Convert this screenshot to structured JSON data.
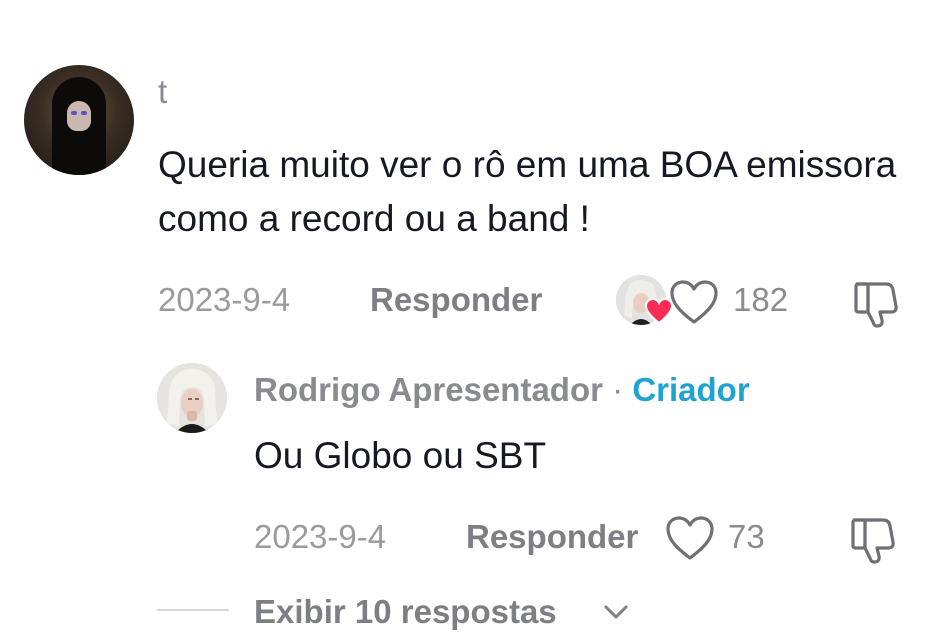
{
  "comment": {
    "username": "t",
    "text": "Queria muito ver o rô em uma BOA emissora como a record ou a band !",
    "date": "2023-9-4",
    "reply_label": "Responder",
    "like_count": "182",
    "avatar_icon": "hooded-figure-avatar",
    "creator_liked_icon": "creator-liked-heart-icon"
  },
  "reply": {
    "username": "Rodrigo Apresentador",
    "separator": "·",
    "creator_badge": "Criador",
    "text": "Ou Globo ou SBT",
    "date": "2023-9-4",
    "reply_label": "Responder",
    "like_count": "73"
  },
  "view_replies": {
    "label": "Exibir 10 respostas"
  },
  "colors": {
    "text_primary": "#161823",
    "text_secondary": "#8a8b91",
    "creator_accent": "#20a3d1",
    "heart_liked": "#fe2c55"
  }
}
